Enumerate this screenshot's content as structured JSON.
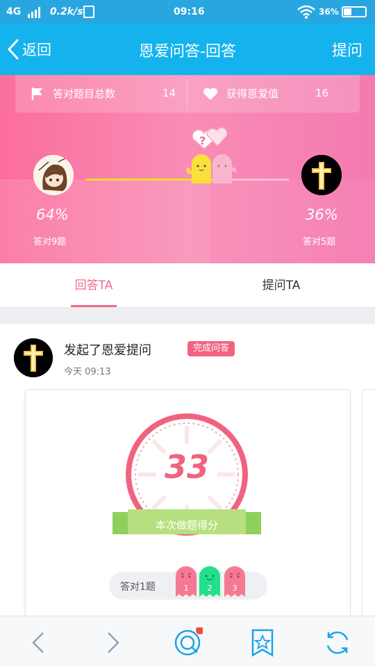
{
  "status_bar": {
    "network": "4G",
    "speed": "0.2k/s",
    "time": "09:16",
    "battery": "36%"
  },
  "nav": {
    "back_label": "返回",
    "title": "恩爱问答-回答",
    "ask_label": "提问"
  },
  "stats": {
    "correct_total_label": "答对题目总数",
    "correct_total_value": "14",
    "love_value_label": "获得恩爱值",
    "love_value": "16"
  },
  "versus": {
    "left_percent": "64%",
    "left_sub": "答对9题",
    "right_percent": "36%",
    "right_sub": "答对5题",
    "left_share": 0.64
  },
  "tabs": [
    {
      "label": "回答TA",
      "active": true
    },
    {
      "label": "提问TA",
      "active": false
    }
  ],
  "post": {
    "title": "发起了恩爱提问",
    "badge": "完成问答",
    "time": "今天  09:13"
  },
  "card": {
    "score": "33",
    "ribbon_text": "本次做题得分",
    "summary_label": "答对1题",
    "answers": [
      {
        "number": "1",
        "correct": false
      },
      {
        "number": "2",
        "correct": true
      },
      {
        "number": "3",
        "correct": false
      }
    ]
  },
  "colors": {
    "nav_blue": "#14b3ee",
    "pink_accent": "#f0637f",
    "correct_green": "#22e08a",
    "wrong_pink": "#f47a93"
  },
  "bottom_bar": {
    "icons": [
      "back-arrow-icon",
      "forward-arrow-icon",
      "qq-chat-icon",
      "bookmark-star-icon",
      "refresh-icon"
    ]
  }
}
